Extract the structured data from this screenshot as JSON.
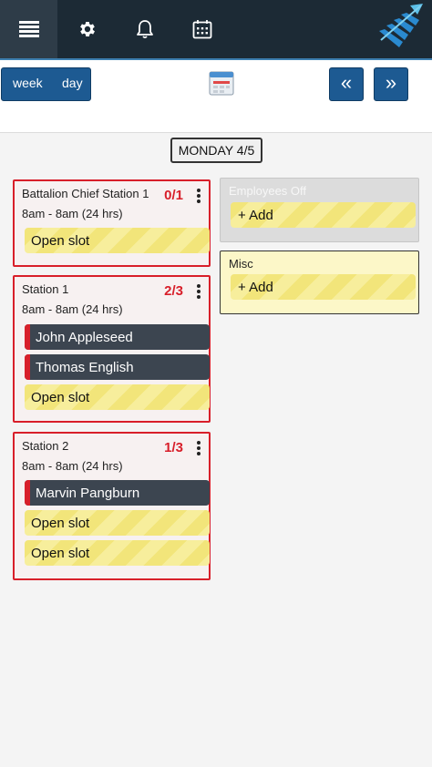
{
  "nav": {
    "items": [
      {
        "name": "menu",
        "icon": "menu-icon",
        "active": true
      },
      {
        "name": "settings",
        "icon": "gear-icon"
      },
      {
        "name": "notifications",
        "icon": "bell-icon"
      },
      {
        "name": "calendar",
        "icon": "calendar-icon"
      }
    ],
    "accent_color": "#3d7fb0",
    "bg_color": "#1c2a35"
  },
  "controls": {
    "week_label": "week",
    "day_label": "day",
    "prev_label": "«",
    "next_label": "»",
    "button_color": "#1d5a92"
  },
  "day_header": "MONDAY 4/5",
  "stations": [
    {
      "title": "Battalion Chief Station 1",
      "hours": "8am - 8am (24 hrs)",
      "count": "0/1",
      "slots": [
        {
          "type": "open",
          "label": "Open slot"
        }
      ]
    },
    {
      "title": "Station 1",
      "hours": "8am - 8am (24 hrs)",
      "count": "2/3",
      "slots": [
        {
          "type": "employee",
          "label": "John Appleseed"
        },
        {
          "type": "employee",
          "label": "Thomas English"
        },
        {
          "type": "open",
          "label": "Open slot"
        }
      ]
    },
    {
      "title": "Station 2",
      "hours": "8am - 8am (24 hrs)",
      "count": "1/3",
      "slots": [
        {
          "type": "employee",
          "label": "Marvin Pangburn"
        },
        {
          "type": "open",
          "label": "Open slot"
        },
        {
          "type": "open",
          "label": "Open slot"
        }
      ]
    }
  ],
  "employees_off": {
    "title": "Employees Off",
    "add_label": "+ Add"
  },
  "misc": {
    "title": "Misc",
    "add_label": "+ Add"
  },
  "colors": {
    "understaffed": "#d81f2a",
    "open_slot": "#f2e57a",
    "employee_slot": "#3c4550"
  }
}
